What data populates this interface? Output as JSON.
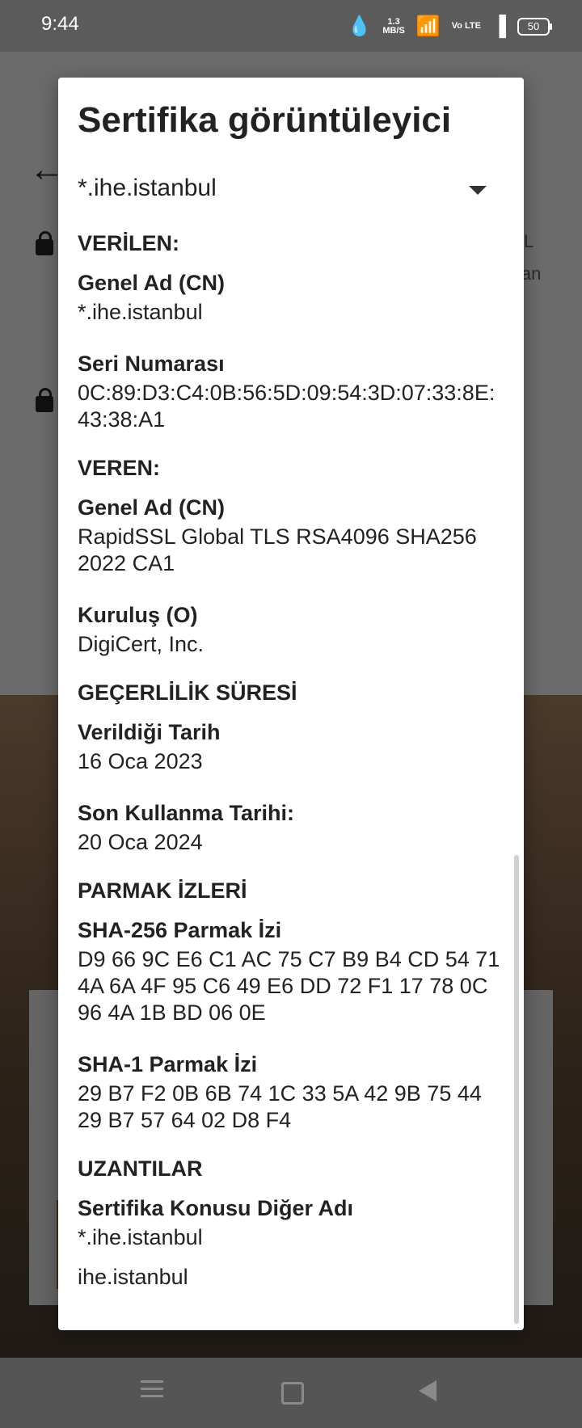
{
  "status_bar": {
    "time": "9:44",
    "data_speed": "1.3",
    "data_unit": "MB/S",
    "volte": "Vo LTE",
    "battery": "50"
  },
  "background": {
    "right_text_1": "L",
    "right_text_2": "lan"
  },
  "dialog": {
    "title": "Sertifika görüntüleyici",
    "selected_certificate": "*.ihe.istanbul",
    "issued_to": {
      "heading": "VERİLEN:",
      "cn_label": "Genel Ad (CN)",
      "cn_value": "*.ihe.istanbul",
      "serial_label": "Seri Numarası",
      "serial_value": "0C:89:D3:C4:0B:56:5D:09:54:3D:07:33:8E:43:38:A1"
    },
    "issued_by": {
      "heading": "VEREN:",
      "cn_label": "Genel Ad (CN)",
      "cn_value": "RapidSSL Global TLS RSA4096 SHA256 2022 CA1",
      "org_label": "Kuruluş (O)",
      "org_value": "DigiCert, Inc."
    },
    "validity": {
      "heading": "GEÇERLİLİK SÜRESİ",
      "issued_label": "Verildiği Tarih",
      "issued_value": "16 Oca 2023",
      "expires_label": "Son Kullanma Tarihi:",
      "expires_value": "20 Oca 2024"
    },
    "fingerprints": {
      "heading": "PARMAK İZLERİ",
      "sha256_label": "SHA-256 Parmak İzi",
      "sha256_value": "D9 66 9C E6 C1 AC 75 C7 B9 B4 CD 54 71 4A 6A 4F 95 C6 49 E6 DD 72 F1 17 78 0C 96 4A 1B BD 06 0E",
      "sha1_label": "SHA-1 Parmak İzi",
      "sha1_value": "29 B7 F2 0B 6B 74 1C 33 5A 42 9B 75 44 29 B7 57 64 02 D8 F4"
    },
    "extensions": {
      "heading": "UZANTILAR",
      "san_label": "Sertifika Konusu Diğer Adı",
      "san_value_1": "*.ihe.istanbul",
      "san_value_2": "ihe.istanbul"
    }
  }
}
